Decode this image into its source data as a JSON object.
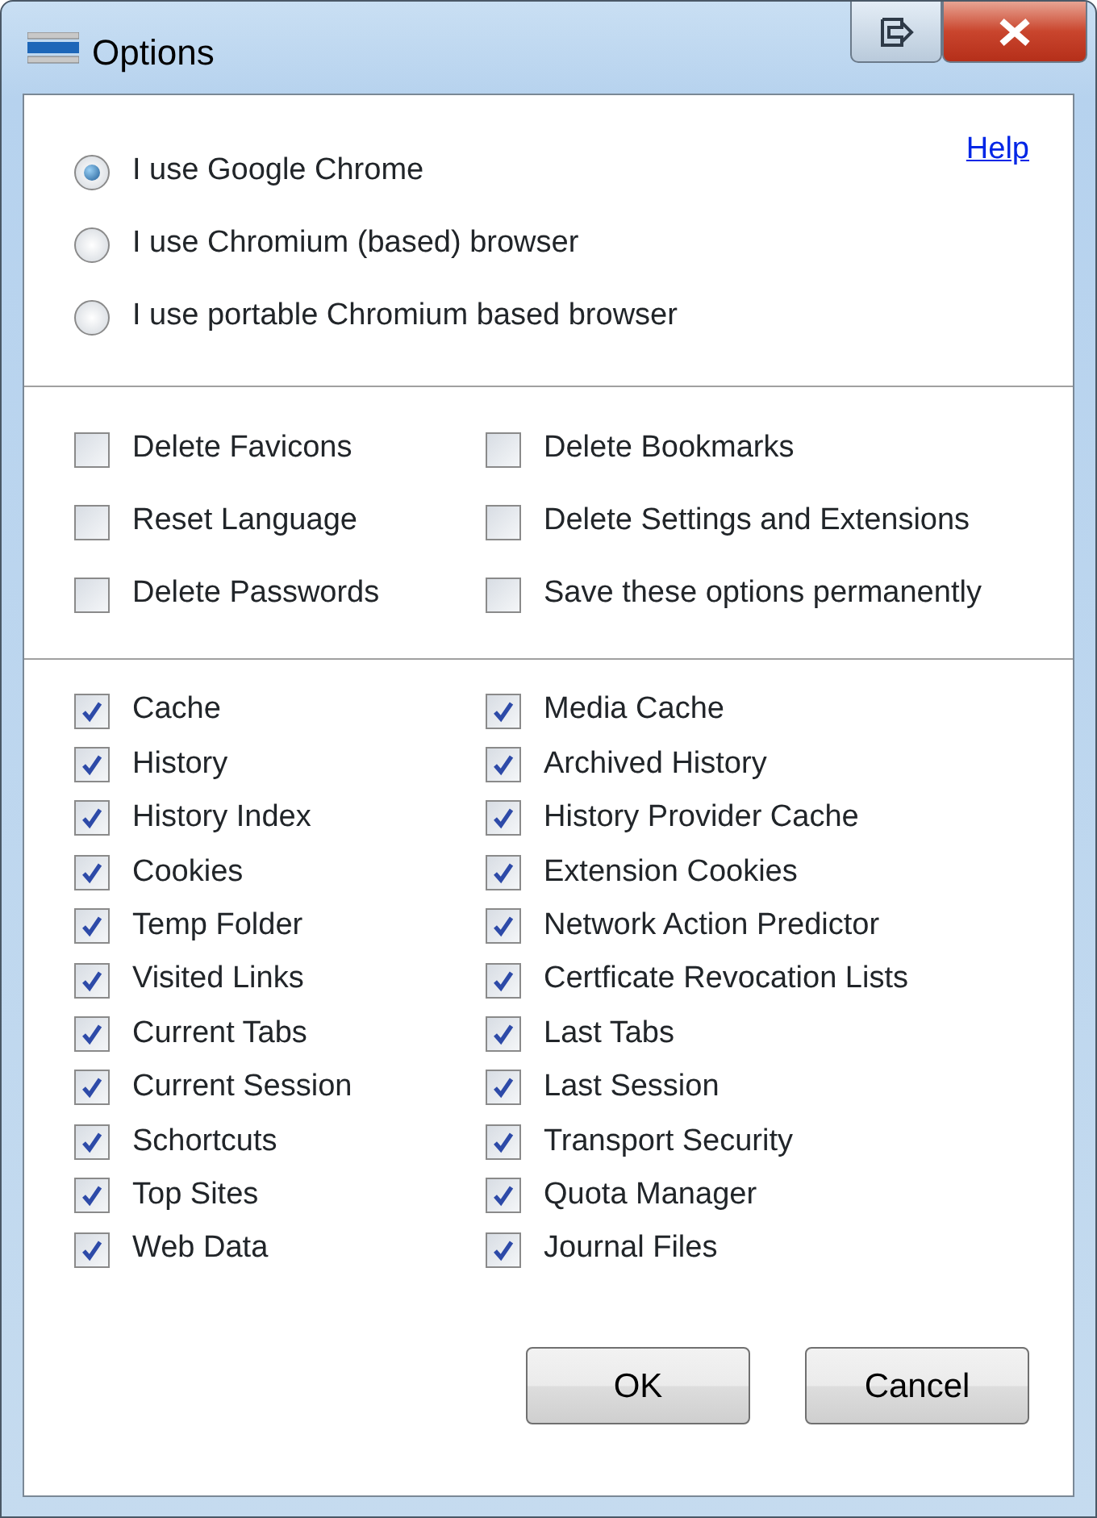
{
  "window": {
    "title": "Options"
  },
  "help_link": "Help",
  "browser_options": [
    {
      "label": "I use Google Chrome",
      "selected": true
    },
    {
      "label": "I use Chromium (based) browser",
      "selected": false
    },
    {
      "label": "I use portable Chromium based browser",
      "selected": false
    }
  ],
  "options": [
    {
      "label": "Delete Favicons",
      "checked": false
    },
    {
      "label": "Delete Bookmarks",
      "checked": false
    },
    {
      "label": "Reset Language",
      "checked": false
    },
    {
      "label": "Delete Settings and Extensions",
      "checked": false
    },
    {
      "label": "Delete Passwords",
      "checked": false
    },
    {
      "label": "Save these options permanently",
      "checked": false
    }
  ],
  "clean_items": [
    {
      "label": "Cache",
      "checked": true
    },
    {
      "label": "Media Cache",
      "checked": true
    },
    {
      "label": "History",
      "checked": true
    },
    {
      "label": "Archived History",
      "checked": true
    },
    {
      "label": "History Index",
      "checked": true
    },
    {
      "label": "History Provider Cache",
      "checked": true
    },
    {
      "label": "Cookies",
      "checked": true
    },
    {
      "label": "Extension Cookies",
      "checked": true
    },
    {
      "label": "Temp Folder",
      "checked": true
    },
    {
      "label": "Network Action Predictor",
      "checked": true
    },
    {
      "label": "Visited Links",
      "checked": true
    },
    {
      "label": "Certficate Revocation Lists",
      "checked": true
    },
    {
      "label": "Current Tabs",
      "checked": true
    },
    {
      "label": "Last Tabs",
      "checked": true
    },
    {
      "label": "Current Session",
      "checked": true
    },
    {
      "label": "Last Session",
      "checked": true
    },
    {
      "label": "Schortcuts",
      "checked": true
    },
    {
      "label": "Transport Security",
      "checked": true
    },
    {
      "label": "Top Sites",
      "checked": true
    },
    {
      "label": "Quota Manager",
      "checked": true
    },
    {
      "label": "Web Data",
      "checked": true
    },
    {
      "label": "Journal Files",
      "checked": true
    }
  ],
  "buttons": [
    "OK",
    "Cancel"
  ]
}
